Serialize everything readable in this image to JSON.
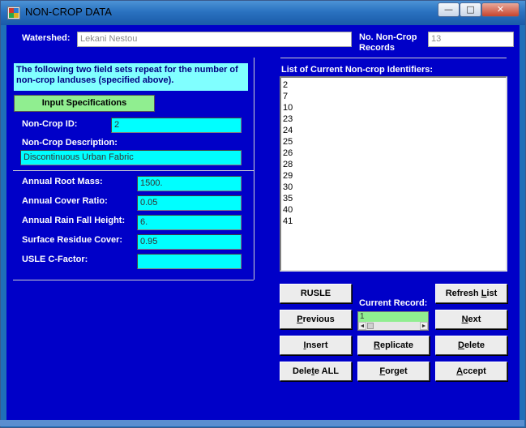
{
  "window": {
    "title": "NON-CROP DATA",
    "minimize_glyph": "—",
    "maximize_glyph": "□",
    "close_glyph": "✕",
    "colors": {
      "client_bg": "#0000c8",
      "field_bg": "#00ffff",
      "info_bg": "#80ffff",
      "accent_green": "#90ee90"
    }
  },
  "header": {
    "watershed_label": "Watershed:",
    "watershed_value": "Lekani Nestou",
    "records_label_line1": "No. Non-Crop",
    "records_label_line2": "Records",
    "records_value": "13"
  },
  "info_box": {
    "line1": "The following two field sets repeat for the number of",
    "line2": "non-crop landuses (specified above)."
  },
  "input_spec_button": "Input Specifications",
  "fields": {
    "id_label": "Non-Crop ID:",
    "id_value": "2",
    "desc_label": "Non-Crop Description:",
    "desc_value": "Discontinuous Urban Fabric",
    "root_mass_label": "Annual Root Mass:",
    "root_mass_value": "1500.",
    "cover_ratio_label": "Annual Cover Ratio:",
    "cover_ratio_value": "0.05",
    "rain_fall_label": "Annual Rain Fall Height:",
    "rain_fall_value": "6.",
    "residue_label": "Surface Residue Cover:",
    "residue_value": "0.95",
    "usle_label": "USLE C-Factor:",
    "usle_value": ""
  },
  "list": {
    "label": "List of Current Non-crop Identifiers:",
    "items": [
      "2",
      "7",
      "10",
      "23",
      "24",
      "25",
      "26",
      "28",
      "29",
      "30",
      "35",
      "40",
      "41"
    ]
  },
  "current_record": {
    "label": "Current Record:",
    "value": "1"
  },
  "buttons": {
    "rusle": "RUSLE",
    "refresh_list_pre": "Refresh ",
    "refresh_list_ul": "L",
    "refresh_list_post": "ist",
    "previous_ul": "P",
    "previous_post": "revious",
    "next_ul": "N",
    "next_post": "ext",
    "insert_ul": "I",
    "insert_post": "nsert",
    "replicate_ul": "R",
    "replicate_post": "eplicate",
    "delete_ul": "D",
    "delete_post": "elete",
    "delete_all_pre": "Dele",
    "delete_all_ul": "t",
    "delete_all_post": "e ALL",
    "forget_ul": "F",
    "forget_post": "orget",
    "accept_ul": "A",
    "accept_post": "ccept"
  }
}
